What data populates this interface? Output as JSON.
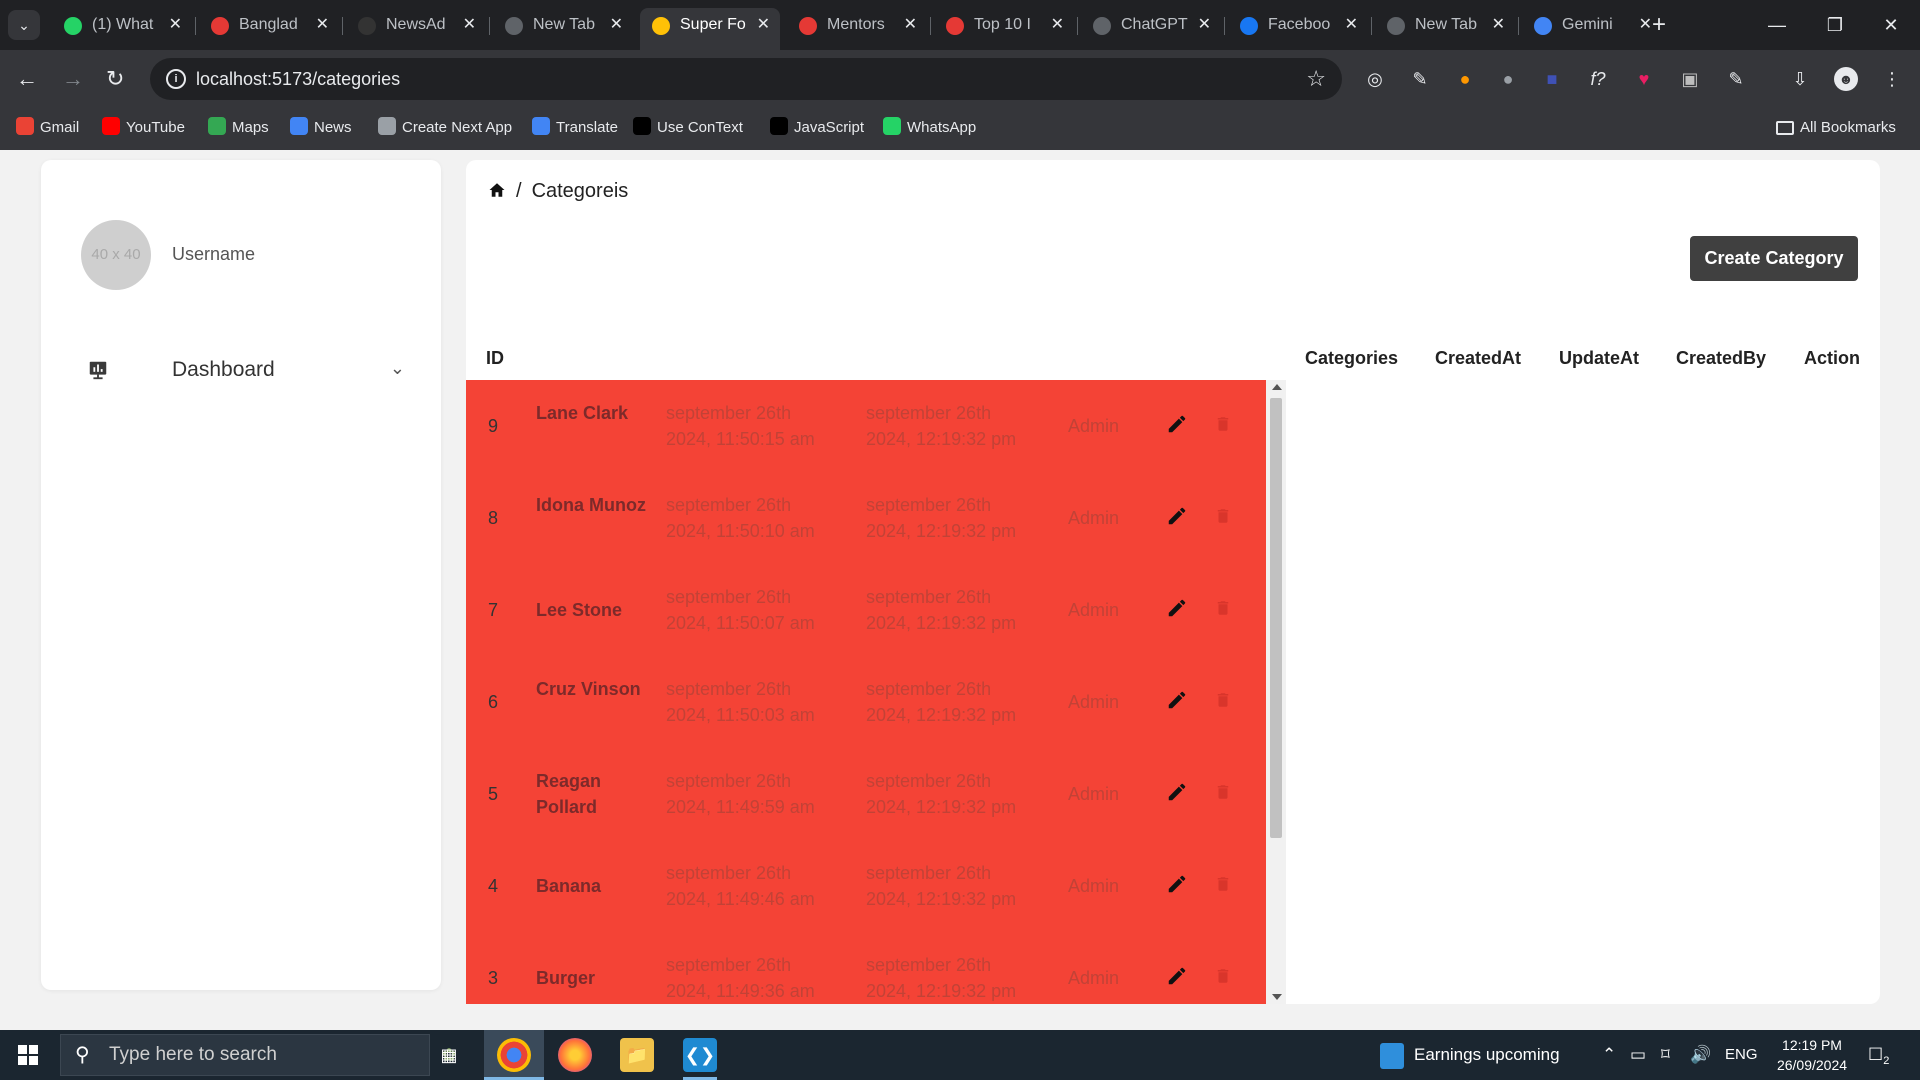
{
  "browser": {
    "tabs": [
      {
        "title": "(1) What",
        "icon": "whatsapp-icon",
        "color": "#25d366"
      },
      {
        "title": "Banglad",
        "icon": "news-icon",
        "color": "#e53935"
      },
      {
        "title": "NewsAd",
        "icon": "newsad-icon",
        "color": "#333333"
      },
      {
        "title": "New Tab",
        "icon": "chrome-icon",
        "color": "#5f6368"
      },
      {
        "title": "Super Fo",
        "icon": "vite-icon",
        "color": "#ffc107"
      },
      {
        "title": "Mentors",
        "icon": "mentor-icon",
        "color": "#e53935"
      },
      {
        "title": "Top 10 I",
        "icon": "top10-icon",
        "color": "#e53935"
      },
      {
        "title": "ChatGPT",
        "icon": "chatgpt-icon",
        "color": "#5f6368"
      },
      {
        "title": "Faceboo",
        "icon": "facebook-icon",
        "color": "#1877f2"
      },
      {
        "title": "New Tab",
        "icon": "chrome-icon",
        "color": "#5f6368"
      },
      {
        "title": "Gemini",
        "icon": "gemini-icon",
        "color": "#4285f4"
      }
    ],
    "url": "localhost:5173/categories",
    "bookmarks": [
      {
        "label": "Gmail",
        "color": "#ea4335"
      },
      {
        "label": "YouTube",
        "color": "#ff0000"
      },
      {
        "label": "Maps",
        "color": "#34a853"
      },
      {
        "label": "News",
        "color": "#4285f4"
      },
      {
        "label": "Create Next App",
        "color": "#9aa0a6"
      },
      {
        "label": "Translate",
        "color": "#4285f4"
      },
      {
        "label": "Use ConText",
        "color": "#000000"
      },
      {
        "label": "JavaScript",
        "color": "#000000"
      },
      {
        "label": "WhatsApp",
        "color": "#25d366"
      }
    ],
    "all_bookmarks": "All Bookmarks"
  },
  "sidebar": {
    "avatar_text": "40 x 40",
    "username": "Username",
    "nav": {
      "label": "Dashboard"
    }
  },
  "main": {
    "breadcrumb": {
      "current": "Categoreis"
    },
    "create_button": "Create Category",
    "table": {
      "headers": {
        "id": "ID",
        "categories": "Categories",
        "created_at": "CreatedAt",
        "update_at": "UpdateAt",
        "created_by": "CreatedBy",
        "action": "Action"
      },
      "row_bg": "#f44336",
      "rows": [
        {
          "id": "9",
          "name": "Lane Clark",
          "created": "september 26th 2024, 11:50:15 am",
          "updated": "september 26th 2024, 12:19:32 pm",
          "by": "Admin"
        },
        {
          "id": "8",
          "name": "Idona Munoz",
          "created": "september 26th 2024, 11:50:10 am",
          "updated": "september 26th 2024, 12:19:32 pm",
          "by": "Admin"
        },
        {
          "id": "7",
          "name": "Lee Stone",
          "created": "september 26th 2024, 11:50:07 am",
          "updated": "september 26th 2024, 12:19:32 pm",
          "by": "Admin"
        },
        {
          "id": "6",
          "name": "Cruz Vinson",
          "created": "september 26th 2024, 11:50:03 am",
          "updated": "september 26th 2024, 12:19:32 pm",
          "by": "Admin"
        },
        {
          "id": "5",
          "name": "Reagan Pollard",
          "created": "september 26th 2024, 11:49:59 am",
          "updated": "september 26th 2024, 12:19:32 pm",
          "by": "Admin"
        },
        {
          "id": "4",
          "name": "Banana",
          "created": "september 26th 2024, 11:49:46 am",
          "updated": "september 26th 2024, 12:19:32 pm",
          "by": "Admin"
        },
        {
          "id": "3",
          "name": "Burger",
          "created": "september 26th 2024, 11:49:36 am",
          "updated": "september 26th 2024, 12:19:32 pm",
          "by": "Admin"
        }
      ]
    }
  },
  "taskbar": {
    "search_placeholder": "Type here to search",
    "weather": "Earnings upcoming",
    "lang": "ENG",
    "time": "12:19 PM",
    "date": "26/09/2024",
    "notification_count": "2"
  }
}
